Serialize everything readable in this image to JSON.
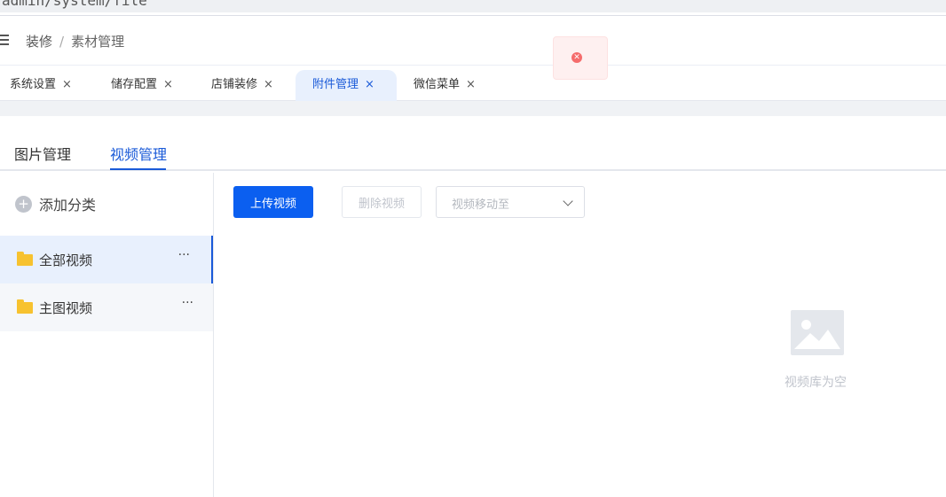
{
  "browser": {
    "address_fragment": "admin/system/file"
  },
  "header": {
    "breadcrumb": [
      "装修",
      "素材管理"
    ],
    "breadcrumb_sep": "/"
  },
  "toast": {
    "type": "error",
    "icon": "close-icon",
    "color": "#f56c6c"
  },
  "tags": [
    {
      "label": "系统设置",
      "active": false
    },
    {
      "label": "储存配置",
      "active": false
    },
    {
      "label": "店铺装修",
      "active": false
    },
    {
      "label": "附件管理",
      "active": true
    },
    {
      "label": "微信菜单",
      "active": false
    }
  ],
  "tag_close": "×",
  "main_tabs": [
    {
      "label": "图片管理",
      "active": false
    },
    {
      "label": "视频管理",
      "active": true
    }
  ],
  "sidebar": {
    "add_label": "添加分类",
    "add_icon": "+",
    "categories": [
      {
        "label": "全部视频",
        "active": true
      },
      {
        "label": "主图视频",
        "active": false
      }
    ],
    "more_glyph": "···"
  },
  "toolbar": {
    "upload_label": "上传视频",
    "delete_label": "删除视频",
    "move_placeholder": "视频移动至"
  },
  "empty": {
    "text": "视频库为空"
  },
  "colors": {
    "accent": "#0b5ff0",
    "active_bg": "#e8f0fd",
    "folder": "#f7c22f"
  }
}
